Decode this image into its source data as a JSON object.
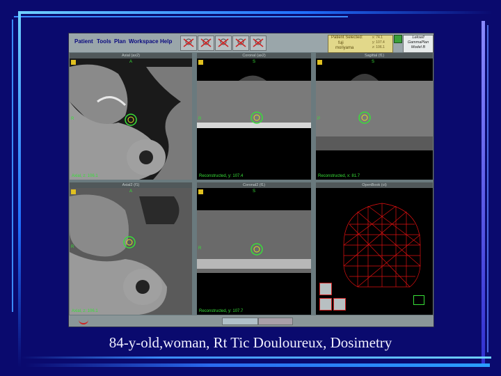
{
  "caption": "84-y-old,woman, Rt Tic Douloureux, Dosimetry",
  "menu": [
    "Patient",
    "Tools",
    "Plan",
    "Workspace",
    "Help"
  ],
  "patient_box": {
    "line1": "Patient Selected:",
    "line2": "fuji",
    "line3": "moriyama"
  },
  "coords": {
    "x": "x: 74.1",
    "y": "y: 107.4",
    "z": "z: 106.1"
  },
  "brand": {
    "line1": "Leksell",
    "line2": "GammaPlan",
    "line3": "Model B"
  },
  "views": [
    {
      "title": "Axial (ax2)",
      "footer": "Axial, z: 106.1",
      "top": "A",
      "side": "R"
    },
    {
      "title": "Coronal (ax2)",
      "footer": "Reconstructed, y: 107.4",
      "top": "S",
      "side": "R"
    },
    {
      "title": "Sagittal (f1)",
      "footer": "Reconstructed, x: 81.7",
      "top": "S",
      "side": "P"
    },
    {
      "title": "Axial2 (f1)",
      "footer": "Axial, z: 106.1",
      "top": "A",
      "side": "R"
    },
    {
      "title": "Coronal2 (f1)",
      "footer": "Reconstructed, y: 107.7",
      "top": "S",
      "side": "R"
    },
    {
      "title": "OpenBook (ct)",
      "footer": "",
      "top": "",
      "side": ""
    }
  ],
  "colors": {
    "background": "#0a0a6e",
    "overlay": "#38e038",
    "mesh": "#e01010"
  },
  "icons": [
    "radiation-tool-icon",
    "lock-icon",
    "head-icon",
    "cube-icon"
  ]
}
